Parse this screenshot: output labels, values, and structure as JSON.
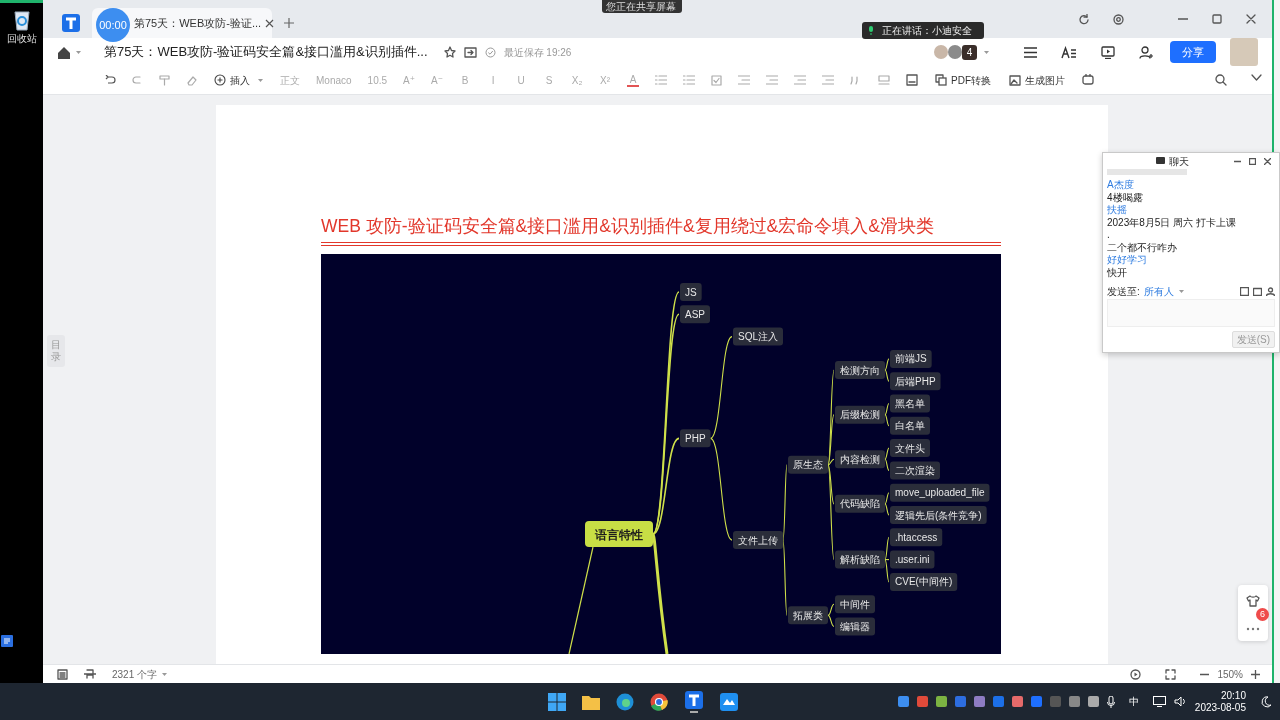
{
  "share_banner": "您正在共享屏幕",
  "desktop": {
    "recycle_bin_label": "回收站"
  },
  "timer": "00:00",
  "tabs": [
    {
      "label": "第75天：WEB攻防-验证...",
      "selected": true
    }
  ],
  "speaking_tooltip": "正在讲话：小迪安全",
  "header": {
    "title": "第75天：WEB攻防-验证码安全篇&接口滥用&识别插件...",
    "save_status": "最近保存 19:26",
    "collaborator_count": "4",
    "share_button": "分享"
  },
  "toolbar": {
    "insert": "插入",
    "paragraph_style": "正文",
    "font": "Monaco",
    "font_size": "10.5",
    "format_glyphs": [
      "A⁺",
      "A⁻",
      "B",
      "I",
      "U",
      "S",
      "X₂",
      "X²"
    ],
    "font_color_glyph": "A",
    "pdf": "PDF转换",
    "image": "生成图片"
  },
  "outline_tab": "目录",
  "document": {
    "heading": "WEB 攻防-验证码安全篇&接口滥用&识别插件&复用绕过&宏命令填入&滑块类",
    "mind_map": {
      "root": {
        "label": "语言特性",
        "children": [
          {
            "label": "JS"
          },
          {
            "label": "ASP"
          },
          {
            "label": "PHP",
            "children": [
              {
                "label": "SQL注入"
              },
              {
                "label": "文件上传",
                "children": [
                  {
                    "label": "原生态",
                    "children": [
                      {
                        "label": "检测方向",
                        "children": [
                          {
                            "label": "前端JS"
                          },
                          {
                            "label": "后端PHP"
                          }
                        ]
                      },
                      {
                        "label": "后缀检测",
                        "children": [
                          {
                            "label": "黑名单"
                          },
                          {
                            "label": "白名单"
                          }
                        ]
                      },
                      {
                        "label": "内容检测",
                        "children": [
                          {
                            "label": "文件头"
                          },
                          {
                            "label": "二次渲染"
                          }
                        ]
                      },
                      {
                        "label": "代码缺陷",
                        "children": [
                          {
                            "label": "move_uploaded_file"
                          },
                          {
                            "label": "逻辑先后(条件竞争)"
                          }
                        ]
                      },
                      {
                        "label": "解析缺陷",
                        "children": [
                          {
                            "label": ".htaccess"
                          },
                          {
                            "label": ".user.ini"
                          },
                          {
                            "label": "CVE(中间件)"
                          }
                        ]
                      }
                    ]
                  },
                  {
                    "label": "拓展类",
                    "children": [
                      {
                        "label": "中间件"
                      },
                      {
                        "label": "编辑器"
                      }
                    ]
                  }
                ]
              }
            ]
          }
        ]
      }
    }
  },
  "chat": {
    "title": "聊天",
    "messages": [
      {
        "kind": "sender",
        "text": "A杰度"
      },
      {
        "kind": "message",
        "text": "4楼喝露"
      },
      {
        "kind": "sender",
        "text": "扶摇"
      },
      {
        "kind": "message",
        "text": "2023年8月5日 周六 打卡上课"
      },
      {
        "kind": "message",
        "text": "."
      },
      {
        "kind": "message",
        "text": "二个都不行咋办"
      },
      {
        "kind": "sender",
        "text": "好好学习"
      },
      {
        "kind": "message",
        "text": "快开"
      }
    ],
    "send_to_label": "发送至:",
    "recipient": "所有人",
    "send_button": "发送(S)"
  },
  "side_badge": "6",
  "status_bar": {
    "word_count": "2321 个字",
    "zoom": "150%"
  },
  "taskbar": {
    "input_method": "中",
    "time": "20:10",
    "date": "2023-08-05"
  }
}
